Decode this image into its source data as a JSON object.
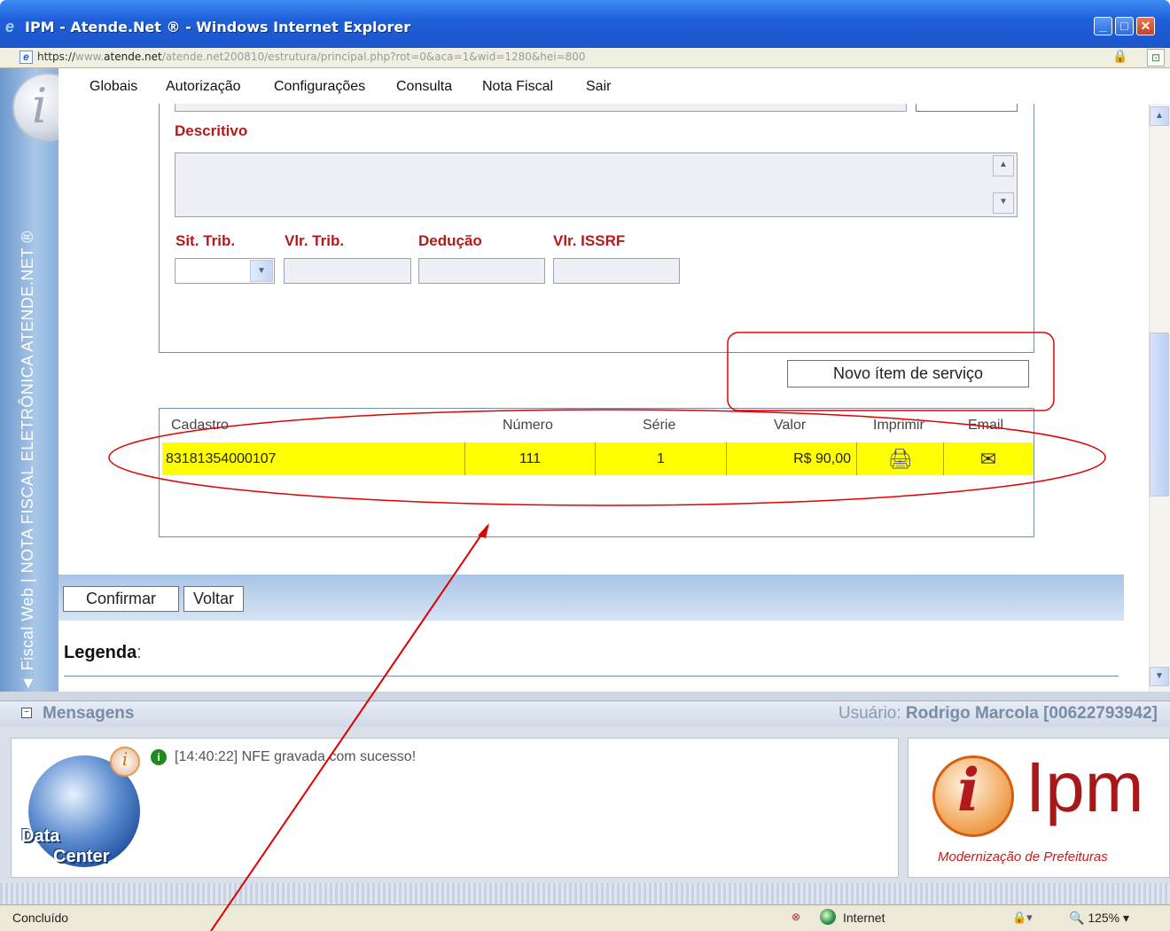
{
  "window": {
    "title": "IPM - Atende.Net ® - Windows Internet Explorer"
  },
  "address": {
    "protocol": "https://",
    "pre_domain": "www.",
    "domain": "atende.net",
    "path": "/atende.net200810/estrutura/principal.php?rot=0&aca=1&wid=1280&hei=800"
  },
  "sidebar": {
    "vertical_text": "◄ Fiscal Web | NOTA FISCAL ELETRÔNICA ATENDE.NET ®"
  },
  "menu": [
    "Globais",
    "Autorização",
    "Configurações",
    "Consulta",
    "Nota Fiscal",
    "Sair"
  ],
  "form": {
    "descritivo_label": "Descritivo",
    "sit_trib_label": "Sit. Trib.",
    "vlr_trib_label": "Vlr. Trib.",
    "deducao_label": "Dedução",
    "vlr_issrf_label": "Vlr. ISSRF",
    "new_item_button": "Novo ítem de serviço"
  },
  "table": {
    "columns": [
      "Cadastro",
      "Número",
      "Série",
      "Valor",
      "Imprimir",
      "Email"
    ],
    "rows": [
      {
        "cadastro": "83181354000107",
        "numero": "111",
        "serie": "1",
        "valor": "R$ 90,00"
      }
    ],
    "highlight_color": "#ffff00"
  },
  "actions": {
    "confirm": "Confirmar",
    "back": "Voltar"
  },
  "legend": {
    "label": "Legenda",
    ":": ":"
  },
  "messages": {
    "header": "Mensagens",
    "user_prefix": "Usuário:",
    "user_name": "Rodrigo Marcola [00622793942]",
    "items": [
      {
        "time": "[14:40:22]",
        "text": "NFE gravada com sucesso!"
      }
    ]
  },
  "logos": {
    "datacenter_line1": "Data",
    "datacenter_line2": "Center",
    "ipm_text": "Ipm",
    "ipm_tagline": "Modernização de Prefeituras"
  },
  "status": {
    "text": "Concluído",
    "zone": "Internet",
    "zoom": "125%"
  },
  "annotation_color": "#e00000"
}
